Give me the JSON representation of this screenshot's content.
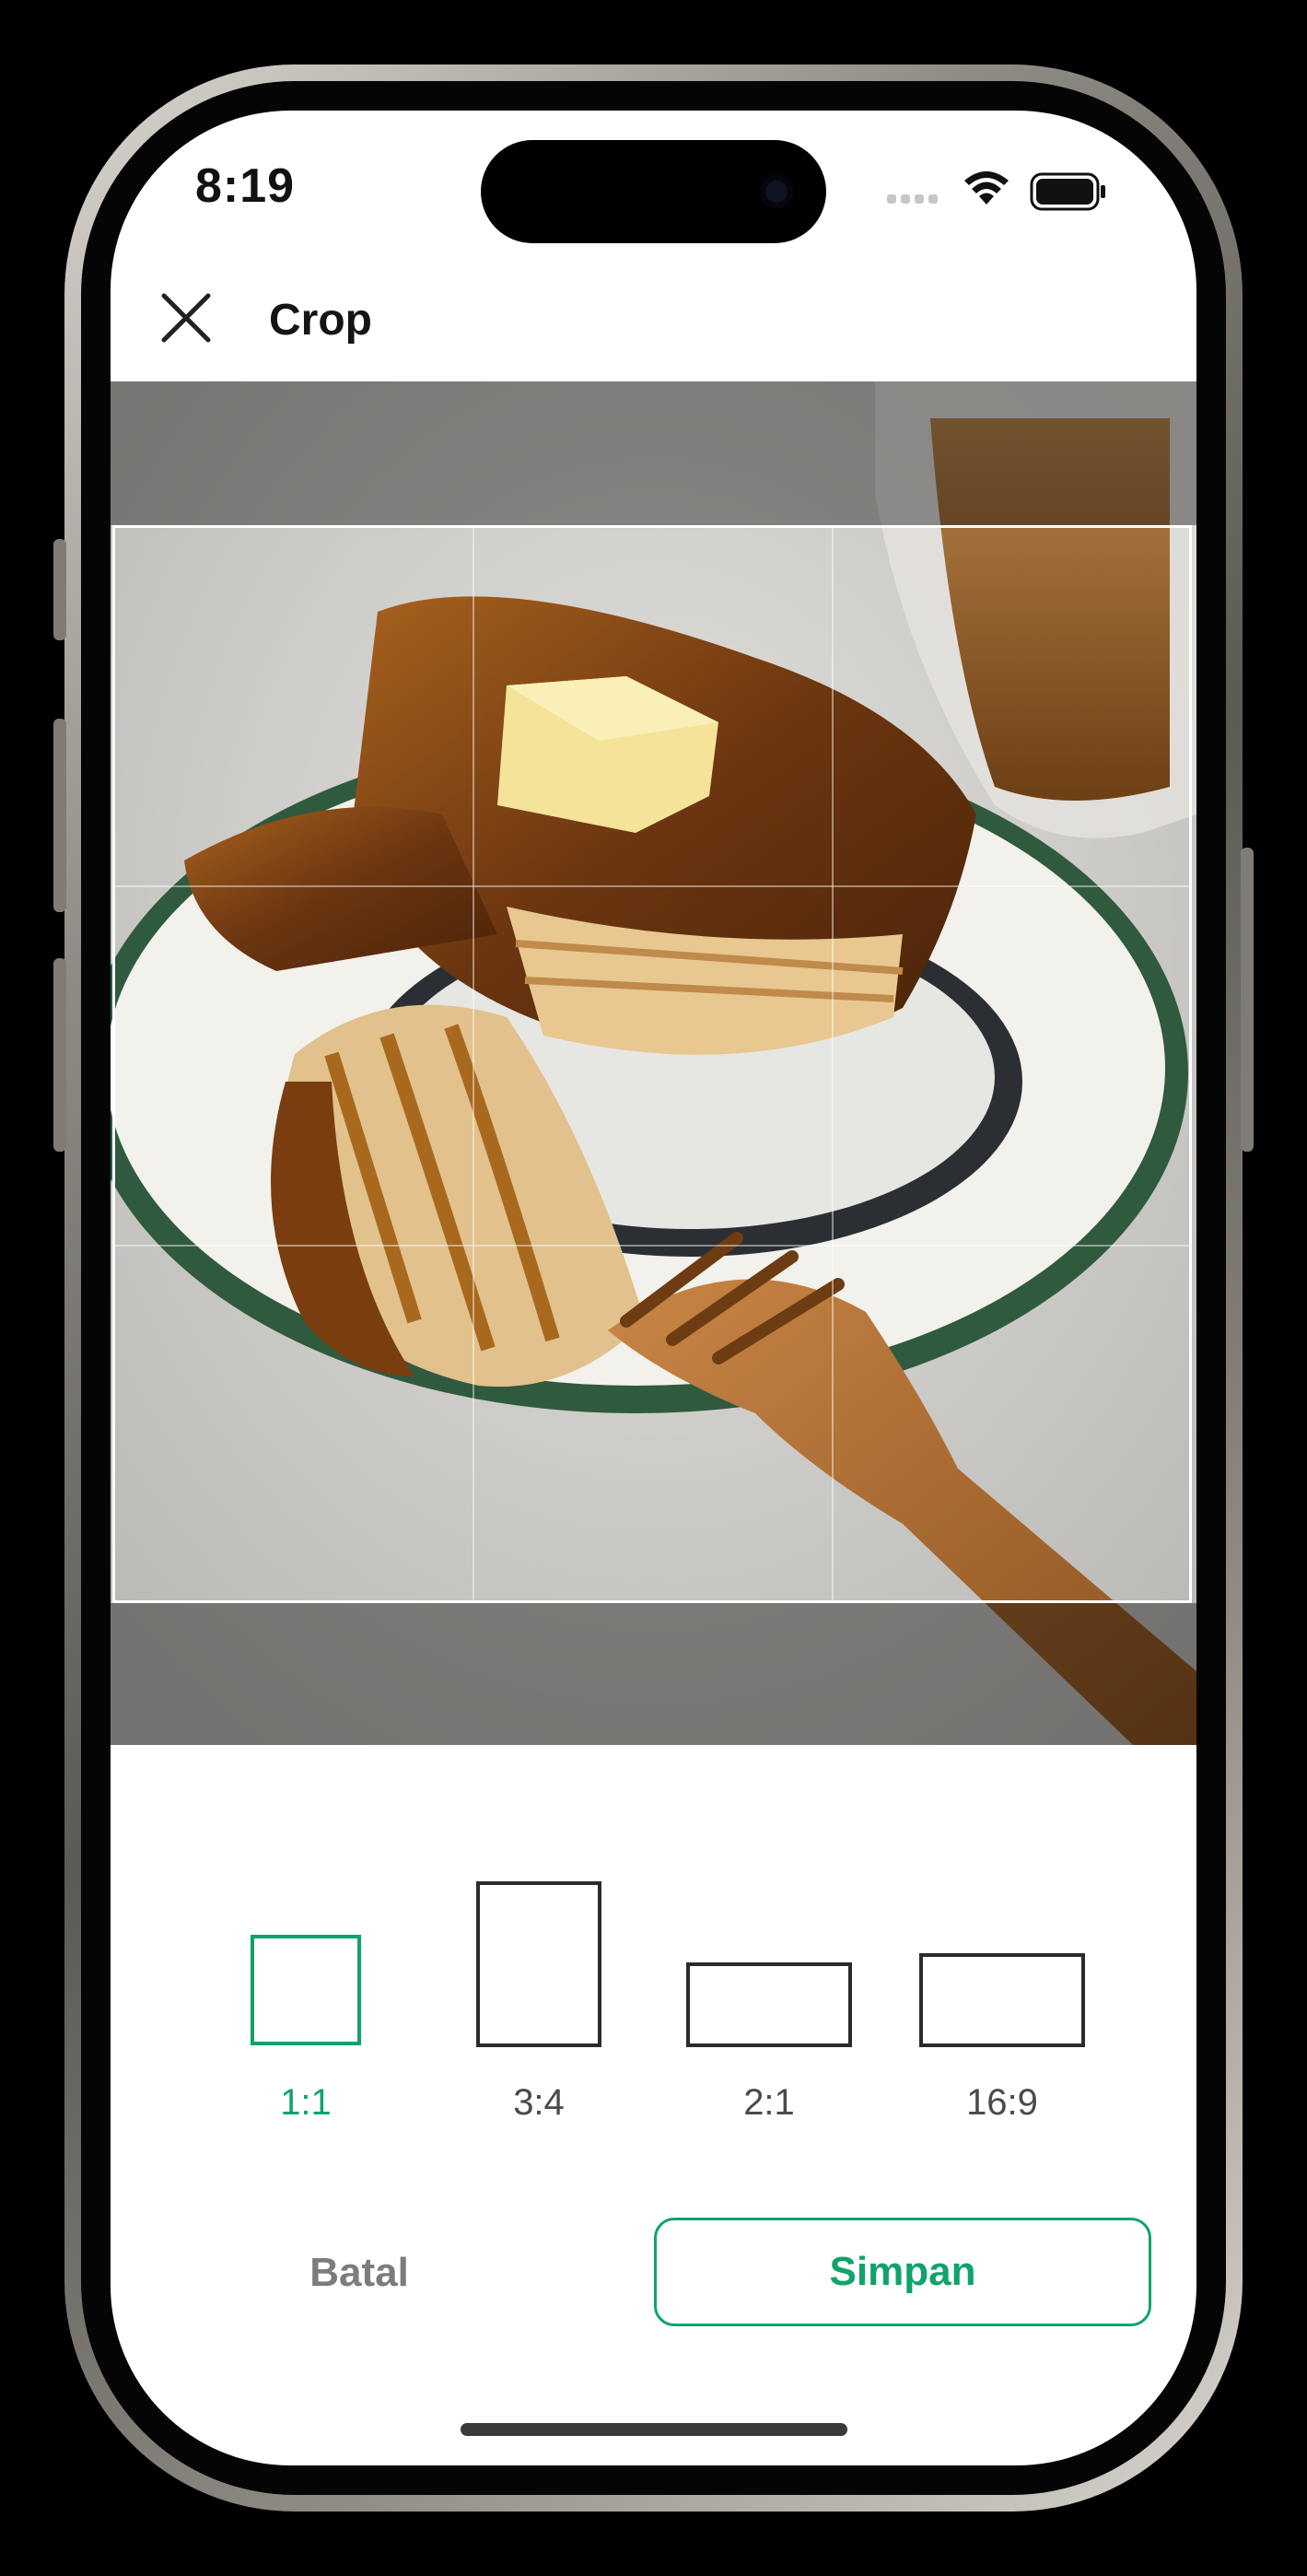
{
  "status_bar": {
    "time": "8:19"
  },
  "header": {
    "title": "Crop",
    "close_icon": "close-icon"
  },
  "aspect_ratios": [
    {
      "label": "1:1",
      "selected": true
    },
    {
      "label": "3:4",
      "selected": false
    },
    {
      "label": "2:1",
      "selected": false
    },
    {
      "label": "16:9",
      "selected": false
    }
  ],
  "actions": {
    "cancel_label": "Batal",
    "save_label": "Simpan"
  },
  "colors": {
    "accent": "#10a36a",
    "text": "#151515",
    "muted": "#7c7c7c"
  }
}
